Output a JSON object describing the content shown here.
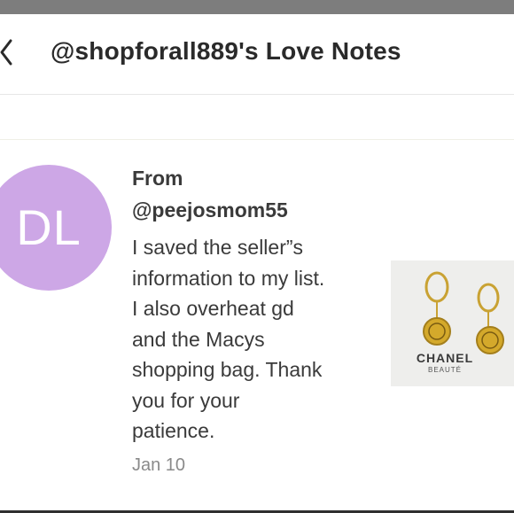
{
  "status_bar": {
    "left_text": "",
    "right_text": ""
  },
  "header": {
    "back_icon": "chevron-left-icon",
    "title": "@shopforall889's Love Notes"
  },
  "note": {
    "avatar_initials": "DL",
    "avatar_color": "#cda7e6",
    "from_label": "From",
    "sender": "@peejosmom55",
    "message_lines": [
      "I saved the seller”s",
      "information to my list.",
      "I also overheat gd",
      "and the Macys",
      "shopping bag. Thank",
      "you for your",
      "patience."
    ],
    "date": "Jan 10",
    "thumbnail": {
      "brand": "CHANEL",
      "brand_sub": "BEAUTÉ"
    }
  }
}
